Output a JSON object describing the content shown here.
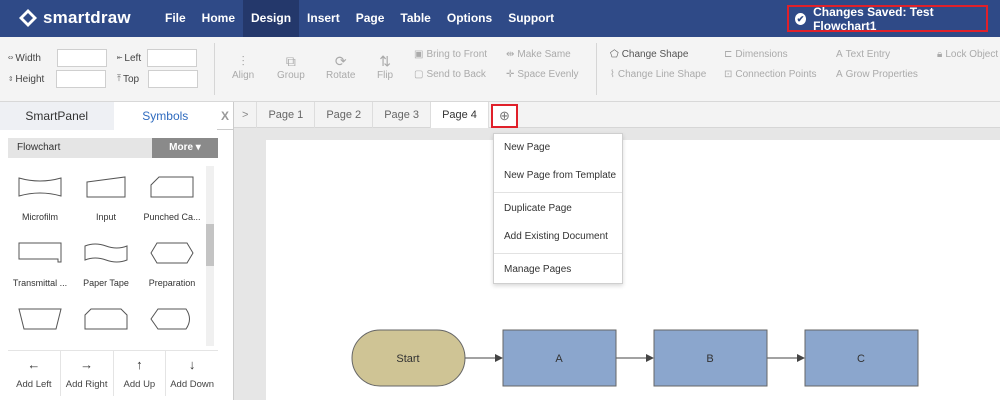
{
  "app": {
    "brand": "smartdraw"
  },
  "menu": [
    "File",
    "Home",
    "Design",
    "Insert",
    "Page",
    "Table",
    "Options",
    "Support"
  ],
  "menu_active": "Design",
  "status": {
    "text": "Changes Saved: Test Flowchart1",
    "highlight_color": "#e0202a"
  },
  "toolbar": {
    "width_label": "Width",
    "height_label": "Height",
    "left_label": "Left",
    "top_label": "Top",
    "width_value": "",
    "height_value": "",
    "left_value": "",
    "top_value": "",
    "align": "Align",
    "group": "Group",
    "rotate": "Rotate",
    "flip": "Flip",
    "bring_front": "Bring to Front",
    "send_back": "Send to Back",
    "make_same": "Make Same",
    "space_evenly": "Space Evenly",
    "change_shape": "Change Shape",
    "change_line": "Change Line Shape",
    "dimensions": "Dimensions",
    "connection_points": "Connection Points",
    "text_entry": "Text Entry",
    "grow_properties": "Grow Properties",
    "lock_object": "Lock Object"
  },
  "panel": {
    "tab_smart": "SmartPanel",
    "tab_symbols": "Symbols",
    "close": "X",
    "library": "Flowchart",
    "more": "More ▾",
    "shapes": [
      "Microfilm",
      "Input",
      "Punched Ca...",
      "Transmittal ...",
      "Paper Tape",
      "Preparation"
    ],
    "add": [
      {
        "arrow": "←",
        "label": "Add Left"
      },
      {
        "arrow": "→",
        "label": "Add Right"
      },
      {
        "arrow": "↑",
        "label": "Add Up"
      },
      {
        "arrow": "↓",
        "label": "Add Down"
      }
    ]
  },
  "pages": {
    "scroll": ">",
    "tabs": [
      "Page 1",
      "Page 2",
      "Page 3",
      "Page 4"
    ],
    "active": "Page 4",
    "add_icon": "⊕"
  },
  "page_menu": [
    "New Page",
    "New Page from Template",
    "Duplicate Page",
    "Add Existing Document",
    "Manage Pages"
  ],
  "flowchart": {
    "nodes": [
      "Start",
      "A",
      "B",
      "C"
    ],
    "start_color": "#cfc495",
    "process_color": "#8ba6cd"
  }
}
